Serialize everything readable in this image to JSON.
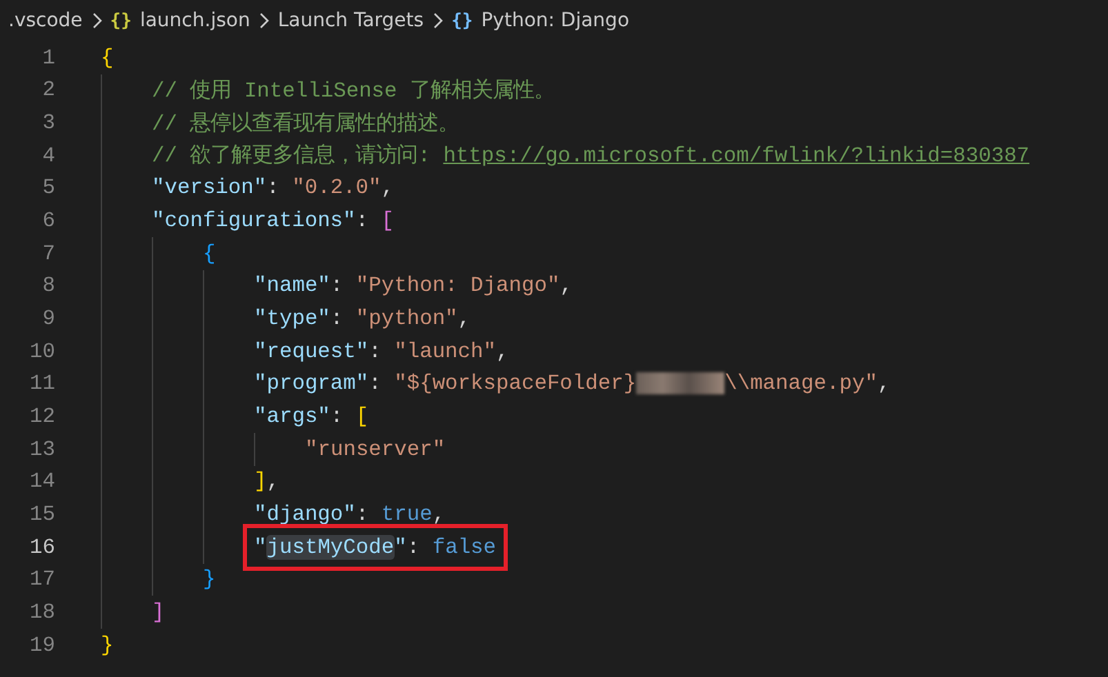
{
  "breadcrumbs": [
    {
      "kind": "folder",
      "label": ".vscode"
    },
    {
      "kind": "file",
      "icon": "{}",
      "label": "launch.json"
    },
    {
      "kind": "group",
      "label": "Launch Targets"
    },
    {
      "kind": "symbol",
      "icon": "{}",
      "label": "Python: Django"
    }
  ],
  "editor": {
    "lines": [
      {
        "number": "1",
        "current": false,
        "marked": false,
        "tokens": [
          {
            "kind": "bracket",
            "color": "#ffd700",
            "text": "{"
          }
        ]
      },
      {
        "number": "2",
        "current": false,
        "marked": false,
        "tokens": [
          {
            "kind": "comment",
            "text": "// 使用 IntelliSense 了解相关属性。"
          }
        ]
      },
      {
        "number": "3",
        "current": false,
        "marked": false,
        "tokens": [
          {
            "kind": "comment",
            "text": "// 悬停以查看现有属性的描述。"
          }
        ]
      },
      {
        "number": "4",
        "current": false,
        "marked": false,
        "tokens": [
          {
            "kind": "comment",
            "text": "// 欲了解更多信息，请访问: "
          },
          {
            "kind": "link",
            "text": "https://go.microsoft.com/fwlink/?linkid=830387"
          }
        ]
      },
      {
        "number": "5",
        "current": false,
        "marked": false,
        "tokens": [
          {
            "kind": "key",
            "text": "\"version\""
          },
          {
            "kind": "punct",
            "text": ": "
          },
          {
            "kind": "string",
            "text": "\"0.2.0\""
          },
          {
            "kind": "punct",
            "text": ","
          }
        ]
      },
      {
        "number": "6",
        "current": false,
        "marked": false,
        "tokens": [
          {
            "kind": "key",
            "text": "\"configurations\""
          },
          {
            "kind": "punct",
            "text": ": "
          },
          {
            "kind": "bracket",
            "color": "#da70d6",
            "text": "["
          }
        ]
      },
      {
        "number": "7",
        "current": false,
        "marked": false,
        "tokens": [
          {
            "kind": "bracket",
            "color": "#179fff",
            "text": "{"
          }
        ]
      },
      {
        "number": "8",
        "current": false,
        "marked": false,
        "tokens": [
          {
            "kind": "key",
            "text": "\"name\""
          },
          {
            "kind": "punct",
            "text": ": "
          },
          {
            "kind": "string",
            "text": "\"Python: Django\""
          },
          {
            "kind": "punct",
            "text": ","
          }
        ]
      },
      {
        "number": "9",
        "current": false,
        "marked": false,
        "tokens": [
          {
            "kind": "key",
            "text": "\"type\""
          },
          {
            "kind": "punct",
            "text": ": "
          },
          {
            "kind": "string",
            "text": "\"python\""
          },
          {
            "kind": "punct",
            "text": ","
          }
        ]
      },
      {
        "number": "10",
        "current": false,
        "marked": false,
        "tokens": [
          {
            "kind": "key",
            "text": "\"request\""
          },
          {
            "kind": "punct",
            "text": ": "
          },
          {
            "kind": "string",
            "text": "\"launch\""
          },
          {
            "kind": "punct",
            "text": ","
          }
        ]
      },
      {
        "number": "11",
        "current": false,
        "marked": false,
        "tokens": [
          {
            "kind": "key",
            "text": "\"program\""
          },
          {
            "kind": "punct",
            "text": ": "
          },
          {
            "kind": "string",
            "text": "\"${workspaceFolder}"
          },
          {
            "kind": "redacted"
          },
          {
            "kind": "string",
            "text": "\\\\manage.py\""
          },
          {
            "kind": "punct",
            "text": ","
          }
        ]
      },
      {
        "number": "12",
        "current": false,
        "marked": false,
        "tokens": [
          {
            "kind": "key",
            "text": "\"args\""
          },
          {
            "kind": "punct",
            "text": ": "
          },
          {
            "kind": "bracket",
            "color": "#ffd700",
            "text": "["
          }
        ]
      },
      {
        "number": "13",
        "current": false,
        "marked": false,
        "tokens": [
          {
            "kind": "string",
            "text": "\"runserver\""
          }
        ]
      },
      {
        "number": "14",
        "current": false,
        "marked": false,
        "tokens": [
          {
            "kind": "bracket",
            "color": "#ffd700",
            "text": "]"
          },
          {
            "kind": "punct",
            "text": ","
          }
        ]
      },
      {
        "number": "15",
        "current": false,
        "marked": false,
        "tokens": [
          {
            "kind": "key",
            "text": "\"django\""
          },
          {
            "kind": "punct",
            "text": ": "
          },
          {
            "kind": "bool",
            "text": "true"
          },
          {
            "kind": "punct",
            "text": ","
          }
        ]
      },
      {
        "number": "16",
        "current": true,
        "marked": true,
        "tokens": [
          {
            "kind": "key",
            "text": "\""
          },
          {
            "kind": "match",
            "text": "justMyCode"
          },
          {
            "kind": "key",
            "text": "\""
          },
          {
            "kind": "punct",
            "text": ": "
          },
          {
            "kind": "bool",
            "text": "false"
          }
        ]
      },
      {
        "number": "17",
        "current": false,
        "marked": false,
        "tokens": [
          {
            "kind": "bracket",
            "color": "#179fff",
            "text": "}"
          }
        ]
      },
      {
        "number": "18",
        "current": false,
        "marked": false,
        "tokens": [
          {
            "kind": "bracket",
            "color": "#da70d6",
            "text": "]"
          }
        ]
      },
      {
        "number": "19",
        "current": false,
        "marked": false,
        "tokens": [
          {
            "kind": "bracket",
            "color": "#ffd700",
            "text": "}"
          }
        ]
      }
    ]
  }
}
